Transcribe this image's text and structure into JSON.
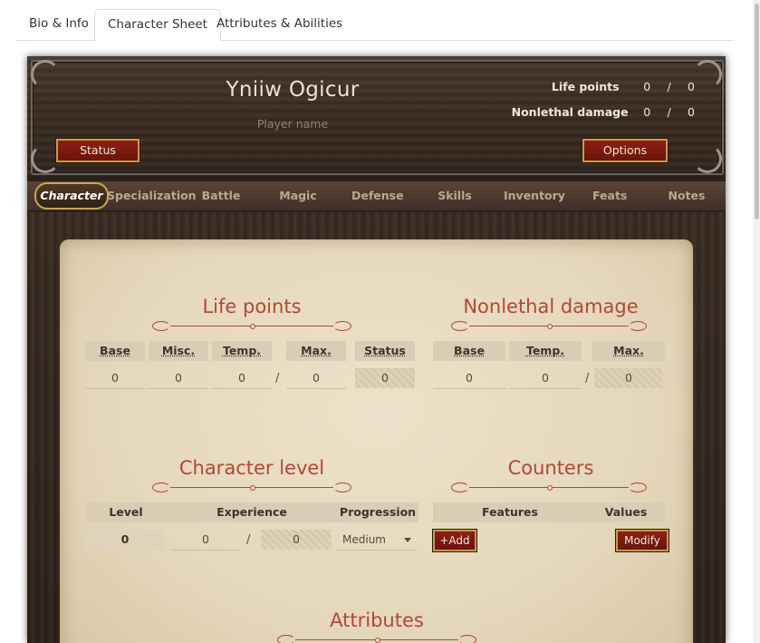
{
  "page_tabs": [
    {
      "label": "Bio & Info"
    },
    {
      "label": "Character Sheet"
    },
    {
      "label": "Attributes & Abilities"
    }
  ],
  "header": {
    "character_name": "Yniiw Ogicur",
    "player_name_placeholder": "Player name",
    "life_points": {
      "label": "Life points",
      "current": "0",
      "separator": "/",
      "max": "0"
    },
    "nonlethal": {
      "label": "Nonlethal damage",
      "current": "0",
      "separator": "/",
      "max": "0"
    },
    "status_button": "Status",
    "options_button": "Options"
  },
  "nav": [
    {
      "label": "Character"
    },
    {
      "label": "Specialization"
    },
    {
      "label": "Battle"
    },
    {
      "label": "Magic"
    },
    {
      "label": "Defense"
    },
    {
      "label": "Skills"
    },
    {
      "label": "Inventory"
    },
    {
      "label": "Feats"
    },
    {
      "label": "Notes"
    }
  ],
  "life_points_section": {
    "title": "Life points",
    "headers": [
      "Base",
      "Misc.",
      "Temp.",
      "Max.",
      "Status"
    ],
    "values": [
      "0",
      "0",
      "0",
      "0",
      "0"
    ],
    "separator": "/"
  },
  "nonlethal_section": {
    "title": "Nonlethal damage",
    "headers": [
      "Base",
      "Temp.",
      "Max."
    ],
    "values": [
      "0",
      "0",
      "0"
    ],
    "separator": "/"
  },
  "character_level_section": {
    "title": "Character level",
    "headers": [
      "Level",
      "Experience",
      "Progression"
    ],
    "level": "0",
    "experience": "0",
    "experience_max": "0",
    "separator": "/",
    "progression": "Medium"
  },
  "counters_section": {
    "title": "Counters",
    "headers": [
      "Features",
      "Values"
    ],
    "add_button": "+Add",
    "modify_button": "Modify"
  },
  "attributes_section": {
    "title": "Attributes"
  },
  "colors": {
    "accent_red": "#b04838",
    "button_red": "#7a1a0e",
    "gold_trim": "#c79a4a",
    "parchment": "#e8dcc4",
    "wood": "#3d2f24"
  }
}
